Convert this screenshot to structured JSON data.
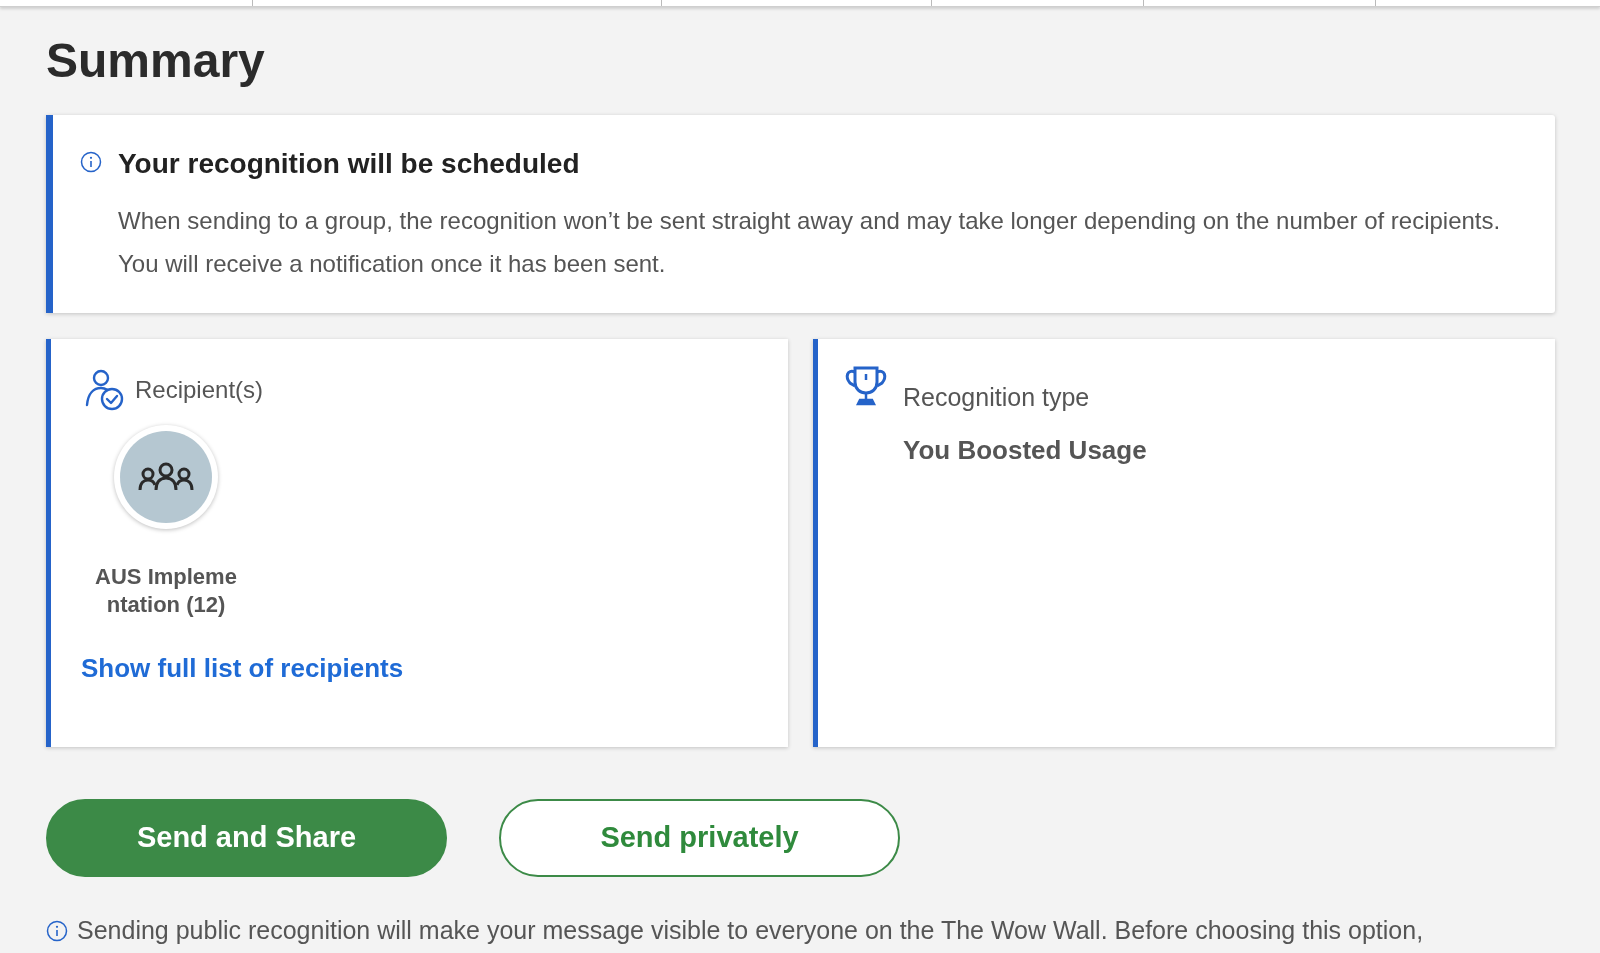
{
  "title": "Summary",
  "notice": {
    "heading": "Your recognition will be scheduled",
    "body": "When sending to a group, the recognition won’t be sent straight away and may take longer depending on the number of recipients. You will receive a notification once it has been sent."
  },
  "recipients": {
    "label": "Recipient(s)",
    "items": [
      {
        "name": "AUS Implementation (12)"
      }
    ],
    "link": "Show full list of recipients"
  },
  "recognition_type": {
    "label": "Recognition type",
    "value": "You Boosted Usage"
  },
  "buttons": [
    {
      "label": "Send and Share",
      "kind": "primary"
    },
    {
      "label": "Send privately",
      "kind": "secondary"
    }
  ],
  "footer_note": "Sending public recognition will make your message visible to everyone on the The Wow Wall. Before choosing this option,"
}
